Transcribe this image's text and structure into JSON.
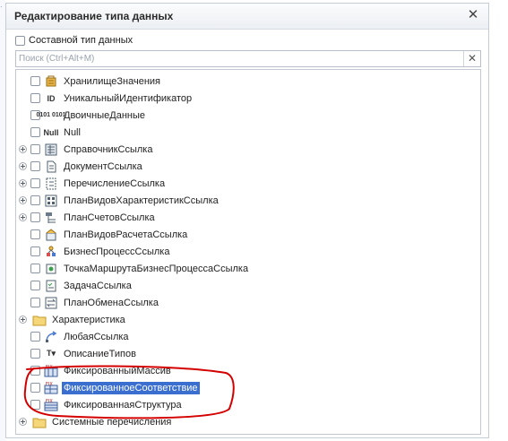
{
  "dialog": {
    "title": "Редактирование типа данных",
    "composite_label": "Составной тип данных",
    "search_placeholder": "Поиск (Ctrl+Alt+M)"
  },
  "types": [
    {
      "label": "ХранилищеЗначения",
      "icon": "storage-icon",
      "expandable": false
    },
    {
      "label": "УникальныйИдентификатор",
      "icon": "id-icon",
      "icon_text": "ID",
      "expandable": false
    },
    {
      "label": "ДвоичныеДанные",
      "icon": "binary-icon",
      "icon_text": "0101 0101",
      "expandable": false
    },
    {
      "label": "Null",
      "icon": "null-icon",
      "icon_text": "Null",
      "expandable": false
    },
    {
      "label": "СправочникСсылка",
      "icon": "catalog-icon",
      "expandable": true
    },
    {
      "label": "ДокументСсылка",
      "icon": "document-icon",
      "expandable": true
    },
    {
      "label": "ПеречислениеСсылка",
      "icon": "enum-icon",
      "expandable": true
    },
    {
      "label": "ПланВидовХарактеристикСсылка",
      "icon": "chart-of-characteristics-icon",
      "expandable": true
    },
    {
      "label": "ПланСчетовСсылка",
      "icon": "chart-of-accounts-icon",
      "expandable": true
    },
    {
      "label": "ПланВидовРасчетаСсылка",
      "icon": "calculation-types-icon",
      "expandable": false
    },
    {
      "label": "БизнесПроцессСсылка",
      "icon": "business-process-icon",
      "expandable": false
    },
    {
      "label": "ТочкаМаршрутаБизнесПроцессаСсылка",
      "icon": "route-point-icon",
      "expandable": false
    },
    {
      "label": "ЗадачаСсылка",
      "icon": "task-icon",
      "expandable": false
    },
    {
      "label": "ПланОбменаСсылка",
      "icon": "exchange-plan-icon",
      "expandable": false
    },
    {
      "label": "Характеристика",
      "icon": "folder-icon",
      "expandable": true,
      "folder": true
    },
    {
      "label": "ЛюбаяСсылка",
      "icon": "any-ref-icon",
      "expandable": false
    },
    {
      "label": "ОписаниеТипов",
      "icon": "type-description-icon",
      "icon_text": "T▾",
      "expandable": false
    },
    {
      "label": "ФиксированныйМассив",
      "icon": "fixed-array-icon",
      "expandable": false
    },
    {
      "label": "ФиксированноеСоответствие",
      "icon": "fixed-map-icon",
      "expandable": false,
      "selected": true
    },
    {
      "label": "ФиксированнаяСтруктура",
      "icon": "fixed-structure-icon",
      "expandable": false
    },
    {
      "label": "Системные перечисления",
      "icon": "folder-icon",
      "expandable": true,
      "folder": true
    }
  ],
  "colors": {
    "selection": "#3a6fcf",
    "annotation": "#d40000"
  }
}
